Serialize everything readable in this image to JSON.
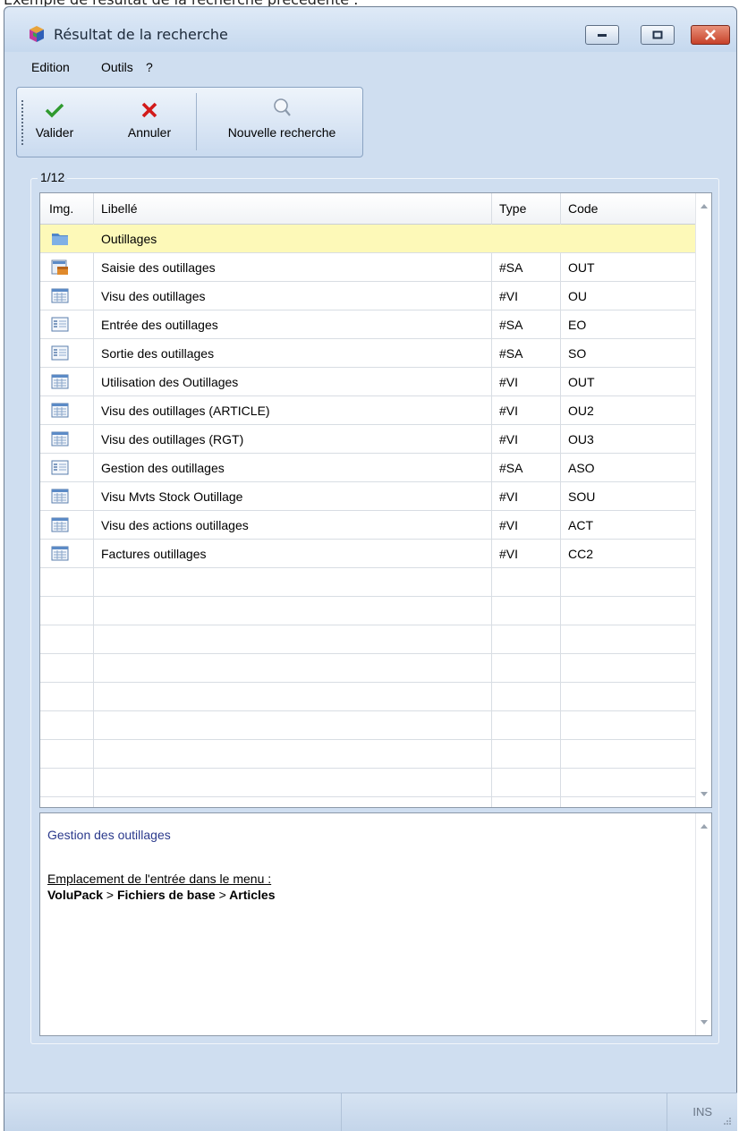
{
  "page_caption": "Exemple de résultat de la recherche précédente :",
  "window": {
    "title": "Résultat de la recherche",
    "controls": [
      "minimize",
      "maximize",
      "close"
    ]
  },
  "menu": [
    "Edition",
    "Outils",
    "?"
  ],
  "toolbar": {
    "valider": {
      "label": "Valider",
      "icon": "check-icon",
      "color": "#2f9a2f"
    },
    "annuler": {
      "label": "Annuler",
      "icon": "x-icon",
      "color": "#d21a1a"
    },
    "nouvelle": {
      "label": "Nouvelle recherche",
      "icon": "magnifier-icon"
    }
  },
  "results": {
    "counter": "1/12",
    "columns": {
      "img": "Img.",
      "libelle": "Libellé",
      "type": "Type",
      "code": "Code"
    },
    "rows": [
      {
        "icon": "folder-icon",
        "libelle": "Outillages",
        "type": "",
        "code": "",
        "selected": true
      },
      {
        "icon": "entry-form-icon",
        "libelle": "Saisie des outillages",
        "type": "#SA",
        "code": "OUT"
      },
      {
        "icon": "grid-view-icon",
        "libelle": "Visu des outillages",
        "type": "#VI",
        "code": "OU"
      },
      {
        "icon": "form-icon",
        "libelle": "Entrée des outillages",
        "type": "#SA",
        "code": "EO"
      },
      {
        "icon": "form-icon",
        "libelle": "Sortie des outillages",
        "type": "#SA",
        "code": "SO"
      },
      {
        "icon": "grid-view-icon",
        "libelle": "Utilisation des Outillages",
        "type": "#VI",
        "code": "OUT"
      },
      {
        "icon": "grid-view-icon",
        "libelle": "Visu des outillages (ARTICLE)",
        "type": "#VI",
        "code": "OU2"
      },
      {
        "icon": "grid-view-icon",
        "libelle": "Visu des outillages (RGT)",
        "type": "#VI",
        "code": "OU3"
      },
      {
        "icon": "form-icon",
        "libelle": "Gestion des outillages",
        "type": "#SA",
        "code": "ASO"
      },
      {
        "icon": "grid-view-icon",
        "libelle": "Visu Mvts Stock Outillage",
        "type": "#VI",
        "code": "SOU"
      },
      {
        "icon": "grid-view-icon",
        "libelle": "Visu des actions outillages",
        "type": "#VI",
        "code": "ACT"
      },
      {
        "icon": "grid-view-icon",
        "libelle": "Factures outillages",
        "type": "#VI",
        "code": "CC2"
      }
    ],
    "selected_color": "#fdf9b8"
  },
  "detail": {
    "title": "Gestion des outillages",
    "location_label": "Emplacement de l'entrée dans le menu :",
    "path": [
      "VoluPack",
      "Fichiers de base",
      "Articles"
    ],
    "separator": ">"
  },
  "statusbar": {
    "mode": "INS"
  }
}
